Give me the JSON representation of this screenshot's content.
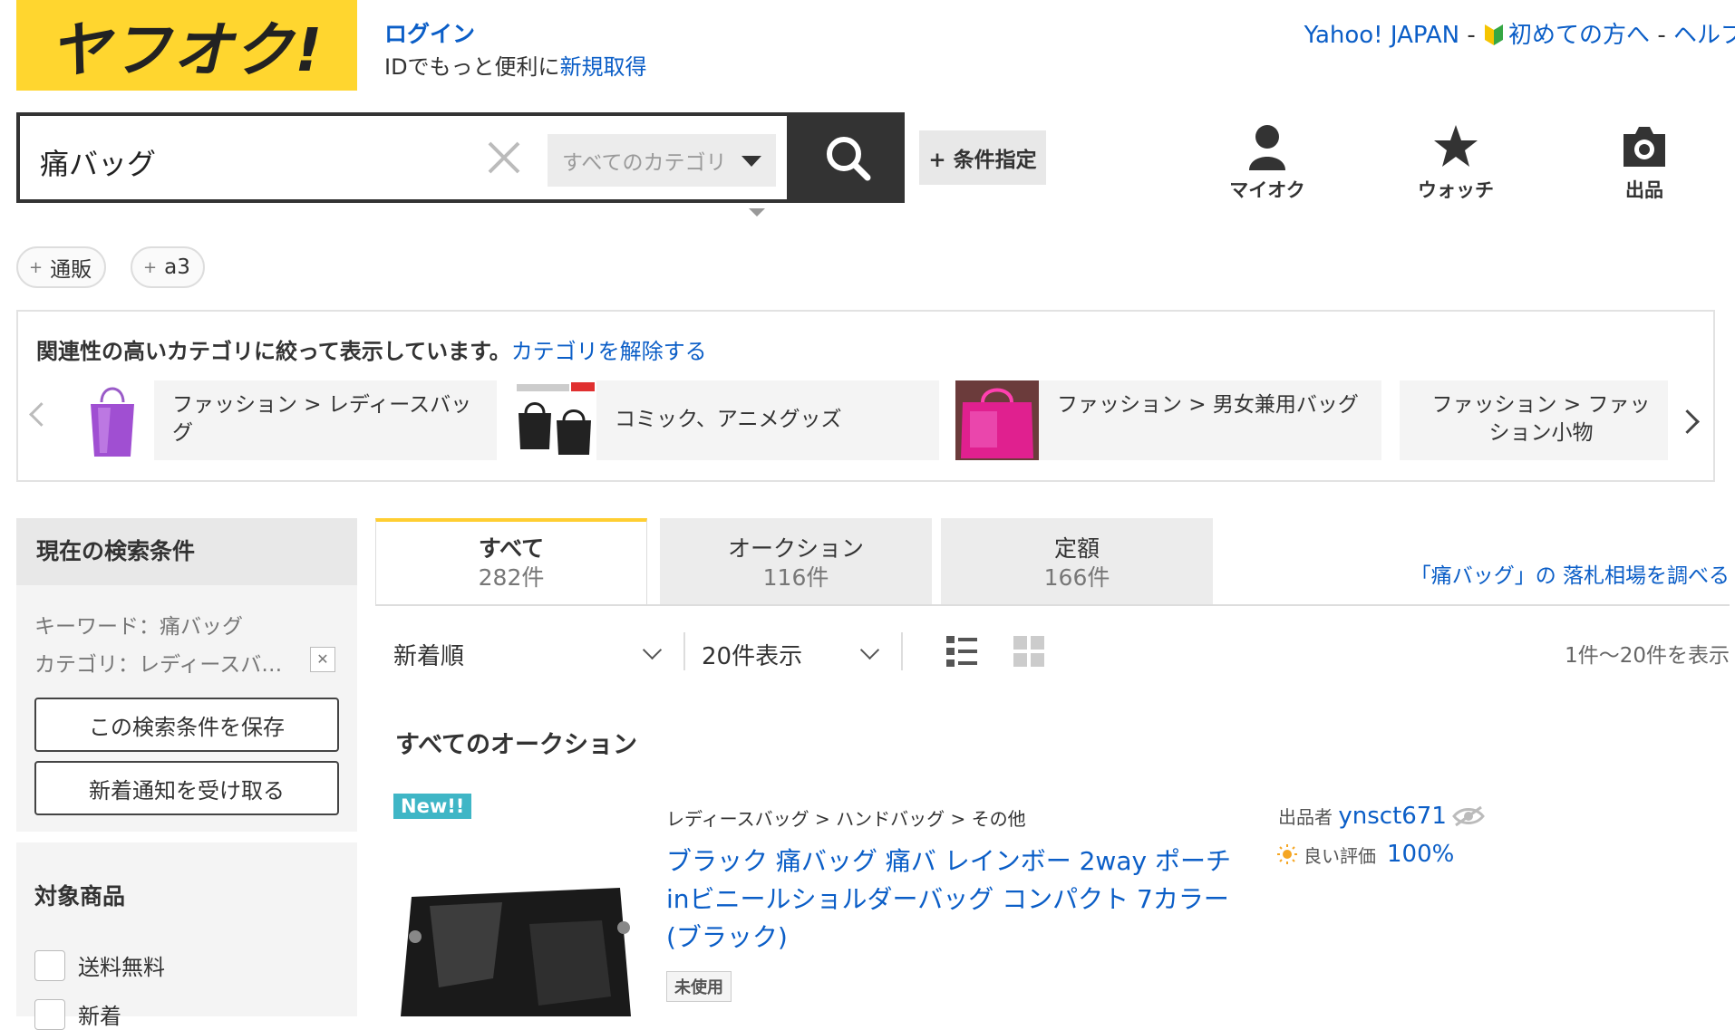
{
  "header": {
    "logo_text": "ヤフオク!",
    "login": "ログイン",
    "id_prefix": "IDでもっと便利に",
    "id_link": "新規取得",
    "links": [
      "Yahoo! JAPAN",
      "初めての方へ",
      "ヘルプ"
    ],
    "separator": " - "
  },
  "search": {
    "query": "痛バッグ",
    "category_placeholder": "すべてのカテゴリ",
    "conditions_button": "+ 条件指定"
  },
  "nav": [
    {
      "label": "マイオク",
      "icon": "user-icon"
    },
    {
      "label": "ウォッチ",
      "icon": "star-icon"
    },
    {
      "label": "出品",
      "icon": "camera-icon"
    }
  ],
  "chips": [
    "通販",
    "a3"
  ],
  "related": {
    "heading": "関連性の高いカテゴリに絞って表示しています。",
    "clear_link": "カテゴリを解除する",
    "cards": [
      {
        "label": "ファッション > レディースバッグ",
        "thumb_color": "#a04fd2"
      },
      {
        "label": "コミック、アニメグッズ",
        "thumb_color": "#222222"
      },
      {
        "label": "ファッション > 男女兼用バッグ",
        "thumb_color": "#e0208f"
      },
      {
        "label": "ファッション > ファッション小物",
        "thumb_color": "#f4f4f4"
      }
    ]
  },
  "sidebar": {
    "current_title": "現在の検索条件",
    "keyword": "キーワード：痛バッグ",
    "category": "カテゴリ：レディースバ…",
    "save_button": "この検索条件を保存",
    "notify_button": "新着通知を受け取る",
    "target_title": "対象商品",
    "checkboxes": [
      "送料無料",
      "新着"
    ]
  },
  "tabs": [
    {
      "label": "すべて",
      "count": "282件",
      "active": true
    },
    {
      "label": "オークション",
      "count": "116件",
      "active": false
    },
    {
      "label": "定額",
      "count": "166件",
      "active": false
    }
  ],
  "market_link": "「痛バッグ」の 落札相場を調べる",
  "sort": {
    "order": "新着順",
    "per_page": "20件表示",
    "count_info": "1件〜20件を表示"
  },
  "section_title": "すべてのオークション",
  "item": {
    "badge": "New!!",
    "breadcrumb": [
      "レディースバッグ",
      "ハンドバッグ",
      "その他"
    ],
    "title": "ブラック 痛バッグ 痛バ レインボー 2way ポーチinビニールショルダーバッグ コンパクト 7カラー(ブラック)",
    "condition": "未使用",
    "seller_label": "出品者",
    "seller": "ynsct671",
    "rating_label": "良い評価",
    "rating": "100%"
  },
  "colors": {
    "brand_yellow": "#ffd62f",
    "link_blue": "#0b5ec7",
    "dark": "#333333",
    "badge_teal": "#3fb6c6"
  }
}
